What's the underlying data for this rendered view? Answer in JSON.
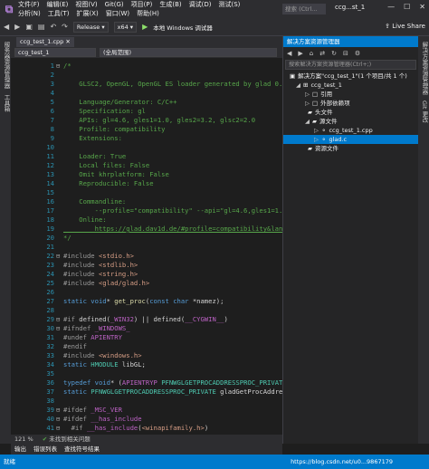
{
  "menu": [
    "文件(F)",
    "编辑(E)",
    "视图(V)",
    "Git(G)",
    "项目(P)",
    "生成(B)",
    "调试(D)",
    "测试(S)",
    "分析(N)",
    "工具(T)",
    "扩展(X)",
    "窗口(W)",
    "帮助(H)"
  ],
  "title": {
    "search_placeholder": "搜索 (Ctrl...",
    "window": "ccg...st_1",
    "minimize": "—",
    "maximize": "☐",
    "close": "✕"
  },
  "toolbar": {
    "config": "Release",
    "platform": "x64",
    "run": "本地 Windows 调试器",
    "live_share": "Live Share"
  },
  "left_strip": {
    "items": [
      "服务器资源管理器",
      "工具箱"
    ]
  },
  "editor_tab": "ccg_test_1.cpp",
  "navbar": {
    "project": "ccg_test_1",
    "scope": "(全局范围)"
  },
  "code": [
    {
      "n": "1",
      "f": "⊟",
      "t": "/*",
      "c": "cm"
    },
    {
      "n": "2",
      "t": "",
      "c": "cm"
    },
    {
      "n": "3",
      "t": "    GLSC2, OpenGL, OpenGL ES loader generated by glad 0.1",
      "c": "cm"
    },
    {
      "n": "4",
      "t": "",
      "c": "cm"
    },
    {
      "n": "5",
      "t": "    Language/Generator: C/C++",
      "c": "cm"
    },
    {
      "n": "6",
      "t": "    Specification: gl",
      "c": "cm"
    },
    {
      "n": "7",
      "t": "    APIs: gl=4.6, gles1=1.0, gles2=3.2, glsc2=2.0",
      "c": "cm"
    },
    {
      "n": "8",
      "t": "    Profile: compatibility",
      "c": "cm"
    },
    {
      "n": "9",
      "t": "    Extensions:",
      "c": "cm"
    },
    {
      "n": "10",
      "t": "",
      "c": "cm"
    },
    {
      "n": "11",
      "t": "    Loader: True",
      "c": "cm"
    },
    {
      "n": "12",
      "t": "    Local files: False",
      "c": "cm"
    },
    {
      "n": "13",
      "t": "    Omit khrplatform: False",
      "c": "cm"
    },
    {
      "n": "14",
      "t": "    Reproducible: False",
      "c": "cm"
    },
    {
      "n": "15",
      "t": "",
      "c": "cm"
    },
    {
      "n": "16",
      "t": "    Commandline:",
      "c": "cm"
    },
    {
      "n": "17",
      "t": "        --profile=\"compatibility\" --api=\"gl=4.6,gles1=1.0",
      "c": "cm"
    },
    {
      "n": "18",
      "t": "    Online:",
      "c": "cm"
    },
    {
      "n": "19",
      "t": "        https://glad.dav1d.de/#profile=compatibility&lang",
      "c": "lk"
    },
    {
      "n": "20",
      "t": "*/",
      "c": "cm"
    },
    {
      "n": "21",
      "t": "",
      "c": "id"
    },
    {
      "n": "22",
      "f": "⊟",
      "t": "#include <stdio.h>",
      "c": "inc"
    },
    {
      "n": "23",
      "t": "#include <stdlib.h>",
      "c": "inc"
    },
    {
      "n": "24",
      "t": "#include <string.h>",
      "c": "inc"
    },
    {
      "n": "25",
      "t": "#include <glad/glad.h>",
      "c": "inc"
    },
    {
      "n": "26",
      "t": "",
      "c": "id"
    },
    {
      "n": "27",
      "t": "static void* get_proc(const char *namez);",
      "c": "proto"
    },
    {
      "n": "28",
      "t": "",
      "c": "id"
    },
    {
      "n": "29",
      "f": "⊟",
      "t": "#if defined(_WIN32) || defined(__CYGWIN__)",
      "c": "pp"
    },
    {
      "n": "30",
      "f": "⊟",
      "t": "#ifndef _WINDOWS_",
      "c": "pp"
    },
    {
      "n": "31",
      "t": "#undef APIENTRY",
      "c": "pp"
    },
    {
      "n": "32",
      "t": "#endif",
      "c": "pp"
    },
    {
      "n": "33",
      "t": "#include <windows.h>",
      "c": "inc"
    },
    {
      "n": "34",
      "t": "static HMODULE libGL;",
      "c": "hm"
    },
    {
      "n": "35",
      "t": "",
      "c": "id"
    },
    {
      "n": "36",
      "t": "typedef void* (APIENTRYP PFNWGLGETPROCADDRESSPROC_PRIVATE",
      "c": "td"
    },
    {
      "n": "37",
      "t": "static PFNWGLGETPROCADDRESSPROC_PRIVATE gladGetProcAddress",
      "c": "sp"
    },
    {
      "n": "38",
      "t": "",
      "c": "id"
    },
    {
      "n": "39",
      "f": "⊟",
      "t": "#ifdef _MSC_VER",
      "c": "pp"
    },
    {
      "n": "40",
      "f": "⊟",
      "t": "#ifdef __has_include",
      "c": "pp"
    },
    {
      "n": "41",
      "f": "⊟",
      "t": "  #if __has_include(<winapifamily.h>)",
      "c": "pp"
    }
  ],
  "editor_status": {
    "zoom": "121 %",
    "issues": "未找到相关问题"
  },
  "output_tabs": [
    "输出",
    "错误列表",
    "查找符号结果"
  ],
  "statusbar": {
    "left": "就绪",
    "right": "https://blog.csdn.net/u0...9867179"
  },
  "solution_explorer": {
    "title": "解决方案资源管理器",
    "search_placeholder": "搜索解决方案资源管理器(Ctrl+;)",
    "tree": [
      {
        "label": "解决方案\"ccg_test_1\"(1 个项目/共 1 个)",
        "depth": 0,
        "arrow": "",
        "icon": "▣",
        "sel": false
      },
      {
        "label": "ccg_test_1",
        "depth": 1,
        "arrow": "◢",
        "icon": "⊞",
        "sel": false
      },
      {
        "label": "引用",
        "depth": 2,
        "arrow": "▷",
        "icon": "□",
        "sel": false
      },
      {
        "label": "外部依赖项",
        "depth": 2,
        "arrow": "▷",
        "icon": "□",
        "sel": false
      },
      {
        "label": "头文件",
        "depth": 2,
        "arrow": "",
        "icon": "▰",
        "sel": false
      },
      {
        "label": "源文件",
        "depth": 2,
        "arrow": "◢",
        "icon": "▰",
        "sel": false
      },
      {
        "label": "ccg_test_1.cpp",
        "depth": 3,
        "arrow": "▷",
        "icon": "⚬",
        "sel": false
      },
      {
        "label": "glad.c",
        "depth": 3,
        "arrow": "▷",
        "icon": "⚬",
        "sel": true
      },
      {
        "label": "资源文件",
        "depth": 2,
        "arrow": "",
        "icon": "▰",
        "sel": false
      }
    ]
  },
  "right_strip": {
    "items": [
      "解决方案资源管理器",
      "Git 更改"
    ]
  }
}
